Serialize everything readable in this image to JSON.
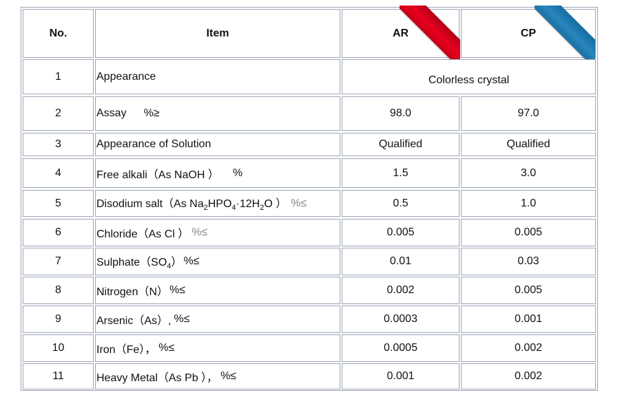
{
  "headers": {
    "no": "No.",
    "item": "Item",
    "ar": "AR",
    "cp": "CP"
  },
  "merged_value": "Colorless crystal",
  "rows": [
    {
      "no": "1",
      "item": "Appearance",
      "ar": "",
      "cp": ""
    },
    {
      "no": "2",
      "item": "Assay",
      "item_unit": "%≥",
      "ar": "98.0",
      "cp": "97.0"
    },
    {
      "no": "3",
      "item": "Appearance of Solution",
      "ar": "Qualified",
      "cp": "Qualified"
    },
    {
      "no": "4",
      "item": "Free alkali（As NaOH ）",
      "item_unit": "%",
      "ar": "1.5",
      "cp": "3.0"
    },
    {
      "no": "5",
      "item_parts": [
        "Disodium salt（As Na",
        "2",
        "HPO",
        "4",
        "·12H",
        "2",
        "O ）"
      ],
      "item_unit": "%≤",
      "ar": "0.5",
      "cp": "1.0"
    },
    {
      "no": "6",
      "item": "Chloride（As Cl ）",
      "item_unit": "%≤",
      "ar": "0.005",
      "cp": "0.005"
    },
    {
      "no": "7",
      "item_parts": [
        "Sulphate（SO",
        "4",
        "）"
      ],
      "item_unit": "%≤",
      "ar": "0.01",
      "cp": "0.03"
    },
    {
      "no": "8",
      "item": "Nitrogen（N）",
      "item_unit": "%≤",
      "ar": "0.002",
      "cp": "0.005"
    },
    {
      "no": "9",
      "item": "Arsenic（As）,",
      "item_unit": "%≤",
      "ar": "0.0003",
      "cp": "0.001"
    },
    {
      "no": "10",
      "item": "Iron（Fe），",
      "item_unit": "%≤",
      "ar": "0.0005",
      "cp": "0.002"
    },
    {
      "no": "11",
      "item": "Heavy Metal（As Pb ），",
      "item_unit": "%≤",
      "ar": "0.001",
      "cp": "0.002"
    }
  ],
  "colors": {
    "grid": "#9aa4b6",
    "ribbon_ar": "#e8001f",
    "ribbon_cp": "#2a86bd",
    "muted": "#888888"
  }
}
